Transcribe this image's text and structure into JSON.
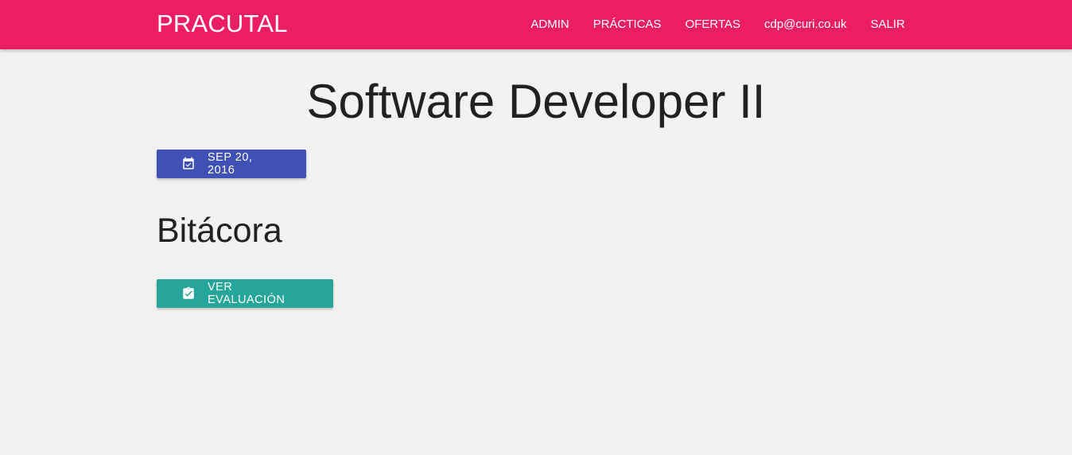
{
  "navbar": {
    "brand": "PRACUTAL",
    "links": [
      "ADMIN",
      "PRÁCTICAS",
      "OFERTAS",
      "cdp@curi.co.uk",
      "SALIR"
    ],
    "color": "#ec1e63"
  },
  "main": {
    "title": "Software Developer II",
    "date_button": {
      "label": "SEP 20, 2016",
      "icon": "calendar-check-icon",
      "color": "#3f51b5"
    },
    "section_title": "Bitácora",
    "eval_button": {
      "label": "VER EVALUACIÓN",
      "icon": "clipboard-check-icon",
      "color": "#26a69a"
    }
  }
}
